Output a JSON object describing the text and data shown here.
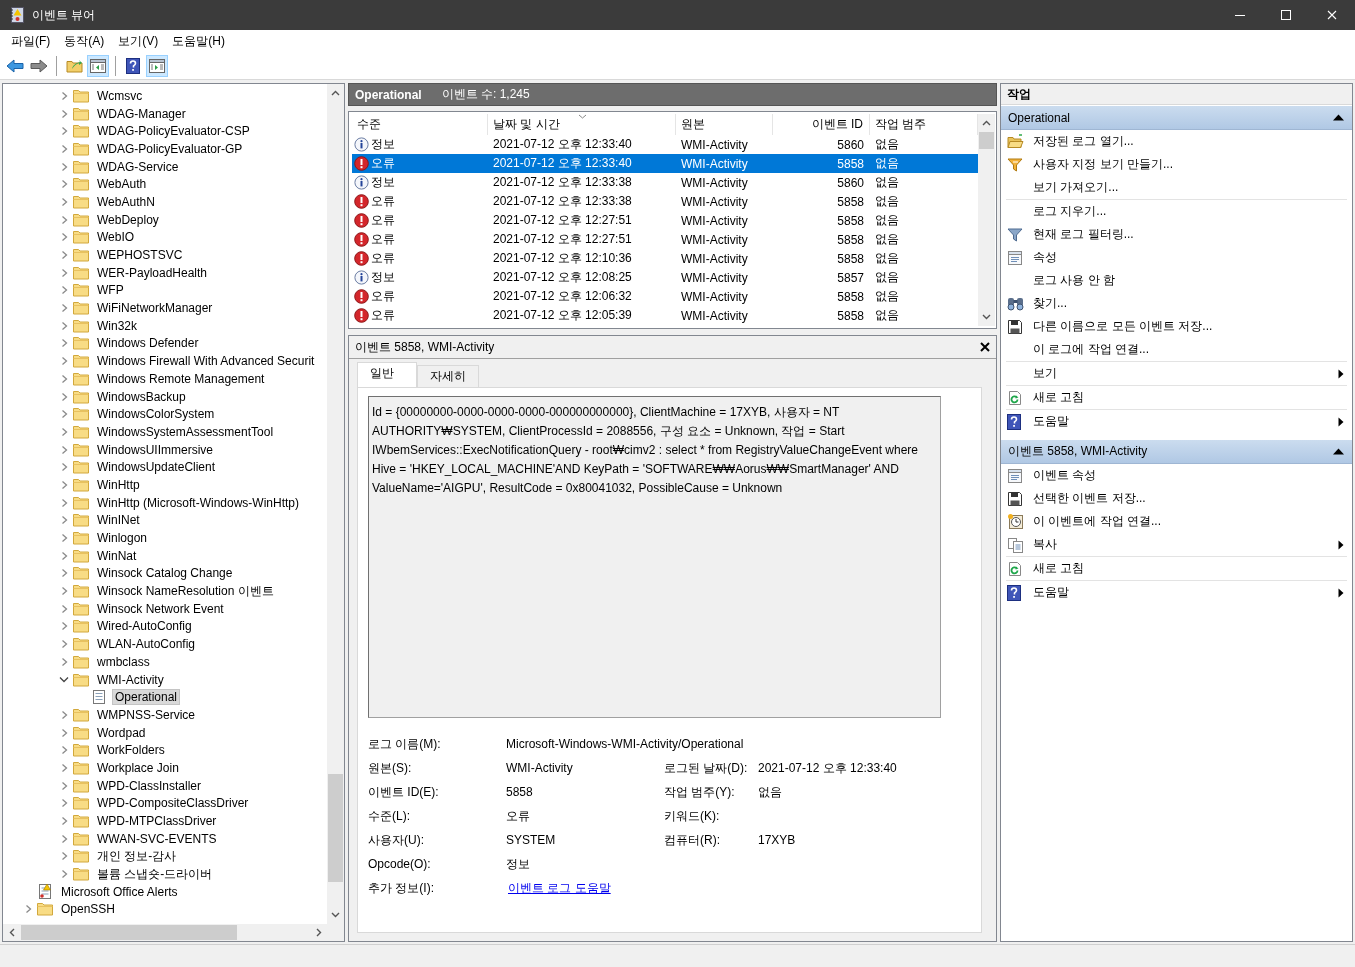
{
  "window": {
    "title": "이벤트 뷰어"
  },
  "menu": [
    "파일(F)",
    "동작(A)",
    "보기(V)",
    "도움말(H)"
  ],
  "toolbar": [
    {
      "kind": "back"
    },
    {
      "kind": "forward"
    },
    {
      "kind": "up",
      "divider_before": true
    },
    {
      "kind": "tree",
      "on": true
    },
    {
      "kind": "help",
      "divider_before": true
    },
    {
      "kind": "actionpane",
      "on": true
    }
  ],
  "tree": {
    "items": [
      {
        "children": [
          {
            "children": [
              {
                "label": "Wcmsvc",
                "kind": "folder",
                "expanded": false,
                "selected": false
              },
              {
                "label": "WDAG-Manager",
                "kind": "folder",
                "expanded": false,
                "selected": false
              },
              {
                "label": "WDAG-PolicyEvaluator-CSP",
                "kind": "folder",
                "expanded": false,
                "selected": false
              },
              {
                "label": "WDAG-PolicyEvaluator-GP",
                "kind": "folder",
                "expanded": false,
                "selected": false
              },
              {
                "label": "WDAG-Service",
                "kind": "folder",
                "expanded": false,
                "selected": false
              },
              {
                "label": "WebAuth",
                "kind": "folder",
                "expanded": false,
                "selected": false
              },
              {
                "label": "WebAuthN",
                "kind": "folder",
                "expanded": false,
                "selected": false
              },
              {
                "label": "WebDeploy",
                "kind": "folder",
                "expanded": false,
                "selected": false
              },
              {
                "label": "WebIO",
                "kind": "folder",
                "expanded": false,
                "selected": false
              },
              {
                "label": "WEPHOSTSVC",
                "kind": "folder",
                "expanded": false,
                "selected": false
              },
              {
                "label": "WER-PayloadHealth",
                "kind": "folder",
                "expanded": false,
                "selected": false
              },
              {
                "label": "WFP",
                "kind": "folder",
                "expanded": false,
                "selected": false
              },
              {
                "label": "WiFiNetworkManager",
                "kind": "folder",
                "expanded": false,
                "selected": false
              },
              {
                "label": "Win32k",
                "kind": "folder",
                "expanded": false,
                "selected": false
              },
              {
                "label": "Windows Defender",
                "kind": "folder",
                "expanded": false,
                "selected": false
              },
              {
                "label": "Windows Firewall With Advanced Securit",
                "kind": "folder",
                "expanded": false,
                "selected": false
              },
              {
                "label": "Windows Remote Management",
                "kind": "folder",
                "expanded": false,
                "selected": false
              },
              {
                "label": "WindowsBackup",
                "kind": "folder",
                "expanded": false,
                "selected": false
              },
              {
                "label": "WindowsColorSystem",
                "kind": "folder",
                "expanded": false,
                "selected": false
              },
              {
                "label": "WindowsSystemAssessmentTool",
                "kind": "folder",
                "expanded": false,
                "selected": false
              },
              {
                "label": "WindowsUIImmersive",
                "kind": "folder",
                "expanded": false,
                "selected": false
              },
              {
                "label": "WindowsUpdateClient",
                "kind": "folder",
                "expanded": false,
                "selected": false
              },
              {
                "label": "WinHttp",
                "kind": "folder",
                "expanded": false,
                "selected": false
              },
              {
                "label": "WinHttp (Microsoft-Windows-WinHttp)",
                "kind": "folder",
                "expanded": false,
                "selected": false
              },
              {
                "label": "WinINet",
                "kind": "folder",
                "expanded": false,
                "selected": false
              },
              {
                "label": "Winlogon",
                "kind": "folder",
                "expanded": false,
                "selected": false
              },
              {
                "label": "WinNat",
                "kind": "folder",
                "expanded": false,
                "selected": false
              },
              {
                "label": "Winsock Catalog Change",
                "kind": "folder",
                "expanded": false,
                "selected": false
              },
              {
                "label": "Winsock NameResolution 이벤트",
                "kind": "folder",
                "expanded": false,
                "selected": false
              },
              {
                "label": "Winsock Network Event",
                "kind": "folder",
                "expanded": false,
                "selected": false
              },
              {
                "label": "Wired-AutoConfig",
                "kind": "folder",
                "expanded": false,
                "selected": false
              },
              {
                "label": "WLAN-AutoConfig",
                "kind": "folder",
                "expanded": false,
                "selected": false
              },
              {
                "label": "wmbclass",
                "kind": "folder",
                "expanded": false,
                "selected": false
              },
              {
                "label": "WMI-Activity",
                "kind": "folder",
                "expanded": true,
                "selected": false,
                "children": [
                  {
                    "label": "Operational",
                    "kind": "log",
                    "selected": true
                  }
                ]
              },
              {
                "label": "WMPNSS-Service",
                "kind": "folder",
                "expanded": false,
                "selected": false
              },
              {
                "label": "Wordpad",
                "kind": "folder",
                "expanded": false,
                "selected": false
              },
              {
                "label": "WorkFolders",
                "kind": "folder",
                "expanded": false,
                "selected": false
              },
              {
                "label": "Workplace Join",
                "kind": "folder",
                "expanded": false,
                "selected": false
              },
              {
                "label": "WPD-ClassInstaller",
                "kind": "folder",
                "expanded": false,
                "selected": false
              },
              {
                "label": "WPD-CompositeClassDriver",
                "kind": "folder",
                "expanded": false,
                "selected": false
              },
              {
                "label": "WPD-MTPClassDriver",
                "kind": "folder",
                "expanded": false,
                "selected": false
              },
              {
                "label": "WWAN-SVC-EVENTS",
                "kind": "folder",
                "expanded": false,
                "selected": false
              },
              {
                "label": "개인 정보-감사",
                "kind": "folder",
                "expanded": false,
                "selected": false
              },
              {
                "label": "볼륨 스냅숏-드라이버",
                "kind": "folder",
                "expanded": false,
                "selected": false
              }
            ]
          }
        ]
      },
      {
        "label": "Microsoft Office Alerts",
        "kind": "alertlog",
        "selected": false
      },
      {
        "label": "OpenSSH",
        "kind": "folder",
        "expanded": false,
        "selected": false
      }
    ]
  },
  "log_header": {
    "title": "Operational",
    "count": "이벤트 수: 1,245"
  },
  "events": {
    "columns": [
      "수준",
      "날짜 및 시간",
      "원본",
      "이벤트 ID",
      "작업 범주"
    ],
    "rows": [
      {
        "kind": "info",
        "level": "정보",
        "date": "2021-07-12 오후 12:33:40",
        "source": "WMI-Activity",
        "id": "5860",
        "category": "없음",
        "selected": false
      },
      {
        "kind": "error",
        "level": "오류",
        "date": "2021-07-12 오후 12:33:40",
        "source": "WMI-Activity",
        "id": "5858",
        "category": "없음",
        "selected": true
      },
      {
        "kind": "info",
        "level": "정보",
        "date": "2021-07-12 오후 12:33:38",
        "source": "WMI-Activity",
        "id": "5860",
        "category": "없음",
        "selected": false
      },
      {
        "kind": "error",
        "level": "오류",
        "date": "2021-07-12 오후 12:33:38",
        "source": "WMI-Activity",
        "id": "5858",
        "category": "없음",
        "selected": false
      },
      {
        "kind": "error",
        "level": "오류",
        "date": "2021-07-12 오후 12:27:51",
        "source": "WMI-Activity",
        "id": "5858",
        "category": "없음",
        "selected": false
      },
      {
        "kind": "error",
        "level": "오류",
        "date": "2021-07-12 오후 12:27:51",
        "source": "WMI-Activity",
        "id": "5858",
        "category": "없음",
        "selected": false
      },
      {
        "kind": "error",
        "level": "오류",
        "date": "2021-07-12 오후 12:10:36",
        "source": "WMI-Activity",
        "id": "5858",
        "category": "없음",
        "selected": false
      },
      {
        "kind": "info",
        "level": "정보",
        "date": "2021-07-12 오후 12:08:25",
        "source": "WMI-Activity",
        "id": "5857",
        "category": "없음",
        "selected": false
      },
      {
        "kind": "error",
        "level": "오류",
        "date": "2021-07-12 오후 12:06:32",
        "source": "WMI-Activity",
        "id": "5858",
        "category": "없음",
        "selected": false
      },
      {
        "kind": "error",
        "level": "오류",
        "date": "2021-07-12 오후 12:05:39",
        "source": "WMI-Activity",
        "id": "5858",
        "category": "없음",
        "selected": false
      }
    ]
  },
  "details": {
    "title": "이벤트 5858, WMI-Activity",
    "tabs": [
      {
        "label": "일반",
        "selected": true
      },
      {
        "label": "자세히",
        "selected": false
      }
    ],
    "message": "Id = {00000000-0000-0000-0000-000000000000}, ClientMachine = 17XYB, 사용자 = NT AUTHORITY₩SYSTEM, ClientProcessId = 2088556, 구성 요소 = Unknown, 작업 = Start IWbemServices::ExecNotificationQuery - root₩cimv2 : select * from RegistryValueChangeEvent where Hive = 'HKEY_LOCAL_MACHINE'AND KeyPath = 'SOFTWARE₩₩Aorus₩₩SmartManager' AND ValueName='AIGPU', ResultCode = 0x80041032, PossibleCause = Unknown",
    "rows": [
      [
        {
          "label": "로그 이름(M):",
          "value": "Microsoft-Windows-WMI-Activity/Operational"
        }
      ],
      [
        {
          "label": "원본(S):",
          "value": "WMI-Activity"
        },
        {
          "label": "로그된 날짜(D):",
          "value": "2021-07-12 오후 12:33:40"
        }
      ],
      [
        {
          "label": "이벤트 ID(E):",
          "value": "5858"
        },
        {
          "label": "작업 범주(Y):",
          "value": "없음"
        }
      ],
      [
        {
          "label": "수준(L):",
          "value": "오류"
        },
        {
          "label": "키워드(K):"
        }
      ],
      [
        {
          "label": "사용자(U):",
          "value": "SYSTEM"
        },
        {
          "label": "컴퓨터(R):",
          "value": "17XYB"
        }
      ],
      [
        {
          "label": "Opcode(O):",
          "value": "정보"
        }
      ],
      [
        {
          "label": "추가 정보(I):",
          "link": "이벤트 로그 도움말"
        }
      ]
    ]
  },
  "actions": {
    "title": "작업",
    "sections": [
      {
        "title": "Operational",
        "expanded": true,
        "items": [
          {
            "label": "저장된 로그 열기...",
            "kind": "open"
          },
          {
            "label": "사용자 지정 보기 만들기...",
            "kind": "createview"
          },
          {
            "label": "보기 가져오기...",
            "kind": "plain"
          },
          {
            "label": "로그 지우기...",
            "kind": "plain",
            "divider_before": true
          },
          {
            "label": "현재 로그 필터링...",
            "kind": "filter"
          },
          {
            "label": "속성",
            "kind": "properties"
          },
          {
            "label": "로그 사용 안 함",
            "kind": "plain"
          },
          {
            "label": "찾기...",
            "kind": "find"
          },
          {
            "label": "다른 이름으로 모든 이벤트 저장...",
            "kind": "save"
          },
          {
            "label": "이 로그에 작업 연결...",
            "kind": "plain"
          },
          {
            "label": "보기",
            "kind": "plain",
            "divider_before": true,
            "submenu": true
          },
          {
            "label": "새로 고침",
            "kind": "refresh",
            "divider_before": true
          },
          {
            "label": "도움말",
            "kind": "help",
            "divider_before": true,
            "submenu": true
          }
        ]
      },
      {
        "title": "이벤트 5858, WMI-Activity",
        "expanded": true,
        "items": [
          {
            "label": "이벤트 속성",
            "kind": "properties"
          },
          {
            "label": "선택한 이벤트 저장...",
            "kind": "save"
          },
          {
            "label": "이 이벤트에 작업 연결...",
            "kind": "attach"
          },
          {
            "label": "복사",
            "kind": "copy",
            "submenu": true
          },
          {
            "label": "새로 고침",
            "kind": "refresh",
            "divider_before": true
          },
          {
            "label": "도움말",
            "kind": "help",
            "divider_before": true,
            "submenu": true
          }
        ]
      }
    ]
  }
}
